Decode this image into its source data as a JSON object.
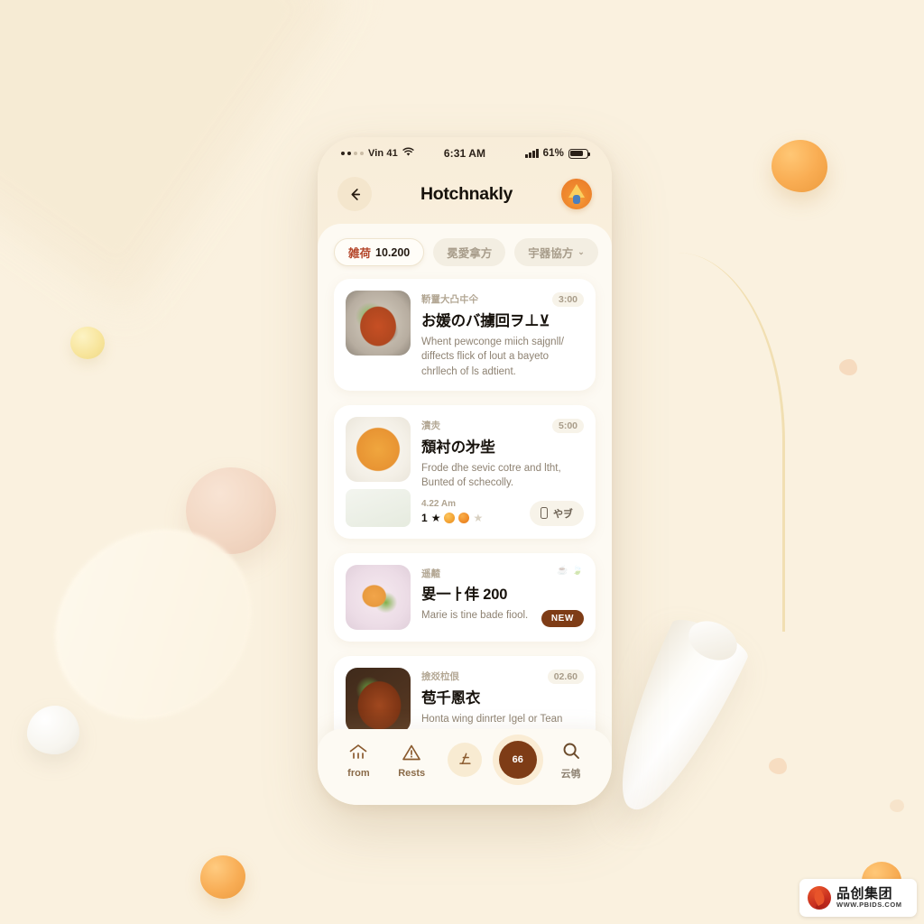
{
  "status_bar": {
    "carrier": "Vin 41",
    "time": "6:31 AM",
    "battery_percent": "61%",
    "wifi_icon": "wifi-icon",
    "signal_icon": "signal-bars-icon",
    "battery_icon": "battery-icon"
  },
  "header": {
    "back_icon": "back-arrow-icon",
    "title": "Hotchnakly",
    "avatar_icon": "avatar-lamp-icon"
  },
  "filters": [
    {
      "cjk": "雑荷",
      "value": "10.200",
      "active": true,
      "has_caret": false
    },
    {
      "cjk": "冕愛拿方",
      "value": "",
      "active": false,
      "has_caret": false
    },
    {
      "cjk": "宇器協方",
      "value": "",
      "active": false,
      "has_caret": true,
      "caret": "⌄"
    }
  ],
  "cards": [
    {
      "kicker": "鞒罿大凸㐄仐",
      "title": "お媛のバ擄回ヲ⊥⊻",
      "desc": "Whent pewconge miich sajgnll/ diffects flick of lout a bayeto chrllech of ls adtient.",
      "time": "3:00",
      "thumb": "thumb-stew",
      "thumb_name": "card-thumbnail-stew"
    },
    {
      "kicker": "漬灻",
      "title": "頹衬の㐧㘹",
      "desc": "Frode dhe sevic cotre and ltht, Bunted of schecolly.",
      "time": "5:00",
      "meta": "4.22 Am",
      "rating_value": "1",
      "stars": [
        "filled",
        "emoji",
        "emoji",
        "muted"
      ],
      "action_label": "やヺ",
      "action_icon": "phone-icon",
      "thumb": "thumb-noodle",
      "thumb_name": "card-thumbnail-noodle",
      "thumb2": "thumb-salad",
      "thumb2_name": "card-thumbnail-salad"
    },
    {
      "kicker": "遥齄",
      "title": "㚻一ㅏ仹 200",
      "desc": "Marie is tine bade fiool.",
      "badge": "NEW",
      "thumb": "thumb-plate",
      "thumb_name": "card-thumbnail-plate"
    },
    {
      "kicker": "撿㸚柆佷",
      "title": "苞千慁衣",
      "desc": "Honta wing dinrter Igel or Tean",
      "time": "02.60",
      "thumb": "thumb-grill",
      "thumb_name": "card-thumbnail-grill"
    }
  ],
  "tabbar": [
    {
      "label": "from",
      "icon": "home-icon",
      "type": "icon"
    },
    {
      "label": "Rests",
      "icon": "warning-triangle-icon",
      "type": "icon"
    },
    {
      "label": "",
      "icon": "arrow-glyph-icon",
      "type": "round"
    },
    {
      "label": "66",
      "icon": "fab-count",
      "type": "fab"
    },
    {
      "label": "云鸲",
      "icon": "search-icon",
      "type": "icon"
    }
  ],
  "watermark": {
    "brand_cn": "品创集团",
    "url": "WWW.PBIDS.COM",
    "logo_icon": "pbids-leaf-logo"
  },
  "colors": {
    "page_background": "#faf1df",
    "card_background": "#ffffff",
    "accent_brown": "#7e3c16",
    "chip_active_text": "#8d3d22",
    "muted_text": "#8e8272"
  }
}
